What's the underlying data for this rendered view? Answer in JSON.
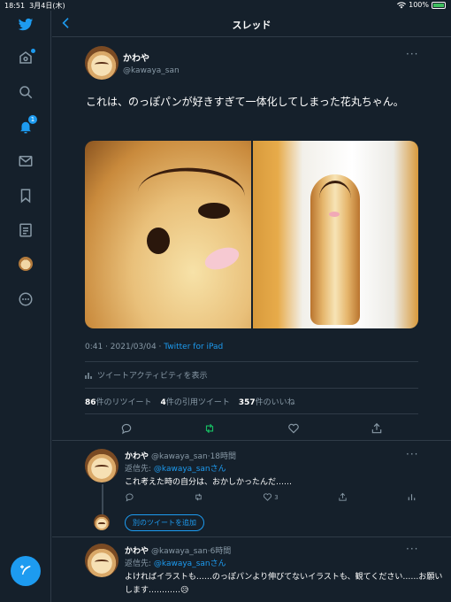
{
  "status_bar": {
    "time": "18:51",
    "date": "3月4日(木)",
    "battery": "100%"
  },
  "header": {
    "title": "スレッド"
  },
  "sidebar": {
    "notification_count": "1"
  },
  "tweet": {
    "display_name": "かわや",
    "handle": "@kawaya_san",
    "text": "これは、のっぽパンが好きすぎて一体化してしまった花丸ちゃん。",
    "timestamp": "0:41 · 2021/03/04 · ",
    "client": "Twitter for iPad",
    "activity_label": "ツイートアクティビティを表示",
    "retweets": "86",
    "retweets_label": "件のリツイート",
    "quotes": "4",
    "quotes_label": "件の引用ツイート",
    "likes": "357",
    "likes_label": "件のいいね"
  },
  "replies": [
    {
      "display_name": "かわや",
      "handle_time": "@kawaya_san·18時間",
      "reply_to_prefix": "返信先: ",
      "reply_to": "@kawaya_sanさん",
      "text": "これ考えた時の自分は、おかしかったんだ……",
      "like_count": "3"
    },
    {
      "display_name": "かわや",
      "handle_time": "@kawaya_san·6時間",
      "reply_to_prefix": "返信先: ",
      "reply_to": "@kawaya_sanさん",
      "text": "よければイラストも……のっぽパンより伸びてないイラストも、観てください……お願いします…………😥"
    }
  ],
  "add_tweet_label": "別のツイートを追加",
  "colors": {
    "background": "#15202b",
    "accent": "#1d9bf0",
    "retweet_green": "#17bf63",
    "secondary_text": "#8899a6"
  }
}
